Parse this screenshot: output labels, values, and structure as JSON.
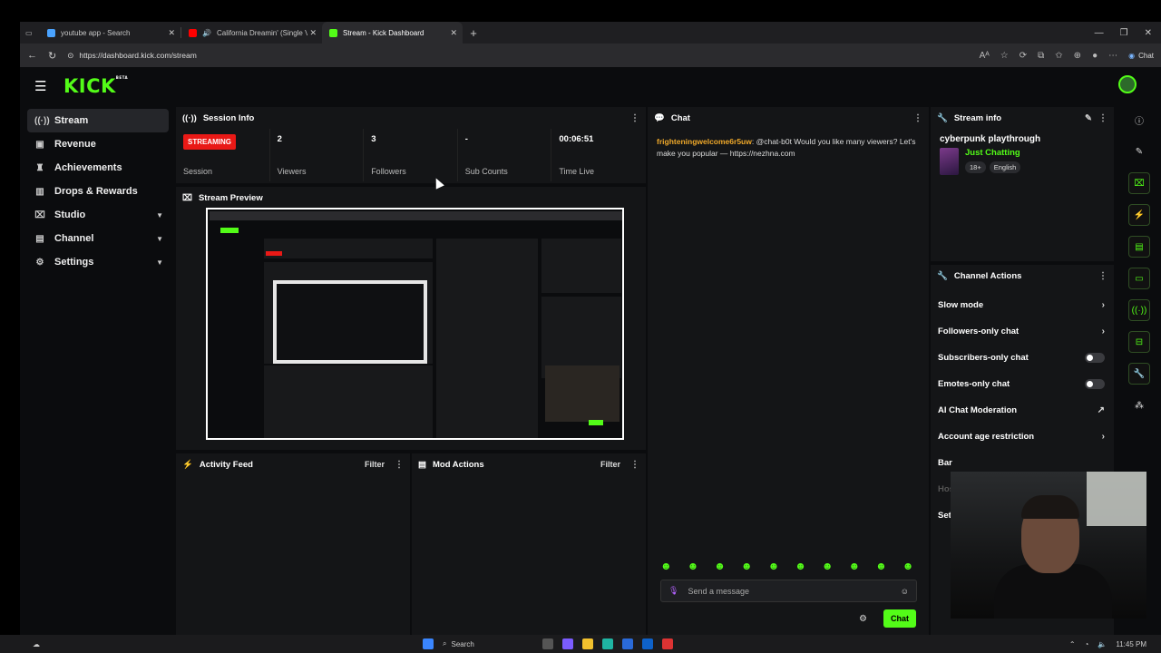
{
  "browser": {
    "tabs": [
      {
        "label": "youtube app - Search",
        "color": "#4aa3ff"
      },
      {
        "label": "California Dreamin' (Single V...",
        "color": "#ff0000"
      },
      {
        "label": "Stream - Kick Dashboard",
        "color": "#53fc18"
      }
    ],
    "url": "https://dashboard.kick.com/stream",
    "copilot_label": "Chat"
  },
  "brand": {
    "logo": "KICK",
    "logo_sup": "BETA"
  },
  "sidebar": {
    "items": [
      {
        "label": "Stream",
        "icon": "broadcast-icon"
      },
      {
        "label": "Revenue",
        "icon": "dollar-icon"
      },
      {
        "label": "Achievements",
        "icon": "trophy-icon"
      },
      {
        "label": "Drops & Rewards",
        "icon": "gift-icon"
      },
      {
        "label": "Studio",
        "icon": "studio-icon"
      },
      {
        "label": "Channel",
        "icon": "channel-icon"
      },
      {
        "label": "Settings",
        "icon": "gear-icon"
      }
    ]
  },
  "session": {
    "title": "Session Info",
    "status_badge": "STREAMING",
    "session_label": "Session",
    "viewers_value": "2",
    "viewers_label": "Viewers",
    "followers_value": "3",
    "followers_label": "Followers",
    "subs_value": "-",
    "subs_label": "Sub Counts",
    "time_value": "00:06:51",
    "time_label": "Time Live"
  },
  "preview": {
    "title": "Stream Preview"
  },
  "activity": {
    "title": "Activity Feed",
    "filter": "Filter"
  },
  "mod_actions": {
    "title": "Mod Actions",
    "filter": "Filter"
  },
  "chat": {
    "title": "Chat",
    "message_user": "frighteningwelcome6r5uw",
    "message_text": ": @chat-b0t Would you like many viewers? Let's make you popular — https://nezhna.com",
    "input_placeholder": "Send a message",
    "send_label": "Chat"
  },
  "stream_info": {
    "title": "Stream info",
    "stream_title": "cyberpunk playthrough",
    "category": "Just Chatting",
    "tags": [
      "18+",
      "English"
    ]
  },
  "channel_actions": {
    "title": "Channel Actions",
    "rows": [
      {
        "label": "Slow mode",
        "control": "›"
      },
      {
        "label": "Followers-only chat",
        "control": "›"
      },
      {
        "label": "Subscribers-only chat",
        "control": "toggle"
      },
      {
        "label": "Emotes-only chat",
        "control": "toggle"
      },
      {
        "label": "AI Chat Moderation",
        "control": "↗"
      },
      {
        "label": "Account age restriction",
        "control": "›"
      },
      {
        "label": "Bar",
        "control": ""
      },
      {
        "label": "Hos",
        "control": ""
      },
      {
        "label": "Set",
        "control": ""
      }
    ]
  },
  "taskbar": {
    "search": "Search",
    "time": "11:45 PM"
  }
}
